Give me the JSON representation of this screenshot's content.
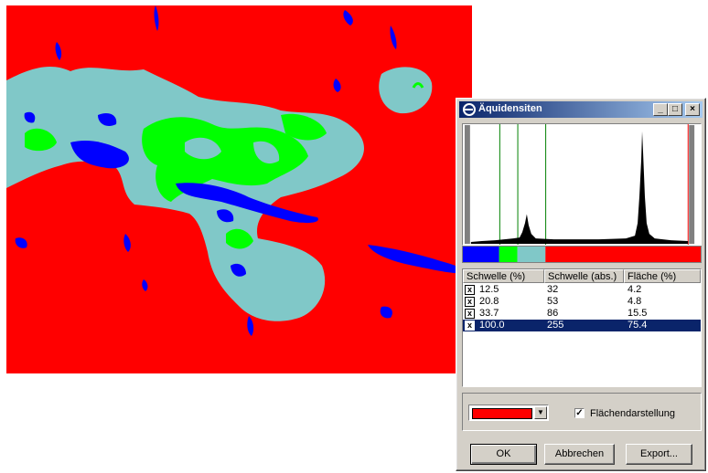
{
  "colors": {
    "background": "#ff0000",
    "class_blue": "#0000ff",
    "class_green": "#00ff00",
    "class_cyan": "#80c8c8",
    "class_red": "#ff0000",
    "selection": "#0a246a"
  },
  "dialog": {
    "title": "Äquidensiten",
    "title_icon": "app-e-icon",
    "minimize": "_",
    "maximize": "□",
    "close": "×",
    "table": {
      "headers": [
        "Schwelle (%)",
        "Schwelle (abs.)",
        "Fläche (%)"
      ],
      "rows": [
        {
          "checked": "x",
          "pct": "12.5",
          "abs": "32",
          "area": "4.2"
        },
        {
          "checked": "x",
          "pct": "20.8",
          "abs": "53",
          "area": "4.8"
        },
        {
          "checked": "x",
          "pct": "33.7",
          "abs": "86",
          "area": "15.5"
        },
        {
          "checked": "x",
          "pct": "100.0",
          "abs": "255",
          "area": "75.4"
        }
      ],
      "selected_row": 3
    },
    "color_dropdown_arrow": "▼",
    "flaechen_checked": "✓",
    "flaechen_label": "Flächendarstellung",
    "ok_label": "OK",
    "cancel_label": "Abbrechen",
    "export_label": "Export..."
  }
}
